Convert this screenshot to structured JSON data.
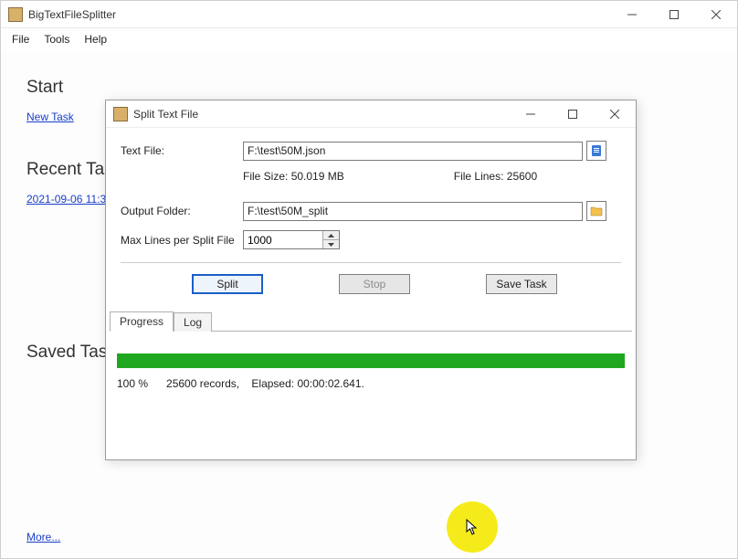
{
  "app": {
    "title": "BigTextFileSplitter"
  },
  "menu": {
    "file": "File",
    "tools": "Tools",
    "help": "Help"
  },
  "main": {
    "start_heading": "Start",
    "new_task": "New Task",
    "recent_heading": "Recent Tas",
    "recent_item_0": "2021-09-06 11:3",
    "saved_heading": "Saved Tas",
    "more": "More..."
  },
  "dialog": {
    "title": "Split Text File",
    "text_file_label": "Text File:",
    "text_file_value": "F:\\test\\50M.json",
    "file_size_label": "File Size: ",
    "file_size_value": "50.019 MB",
    "file_lines_label": "File Lines: ",
    "file_lines_value": "25600",
    "output_folder_label": "Output Folder:",
    "output_folder_value": "F:\\test\\50M_split",
    "max_lines_label": "Max Lines per Split File",
    "max_lines_value": "1000",
    "split_btn": "Split",
    "stop_btn": "Stop",
    "save_task_btn": "Save Task",
    "tab_progress": "Progress",
    "tab_log": "Log",
    "status": "100 %      25600 records,    Elapsed: 00:00:02.641."
  },
  "colors": {
    "link": "#1a3fc8",
    "progress": "#1fa81f",
    "highlight": "#f5eb1a"
  }
}
